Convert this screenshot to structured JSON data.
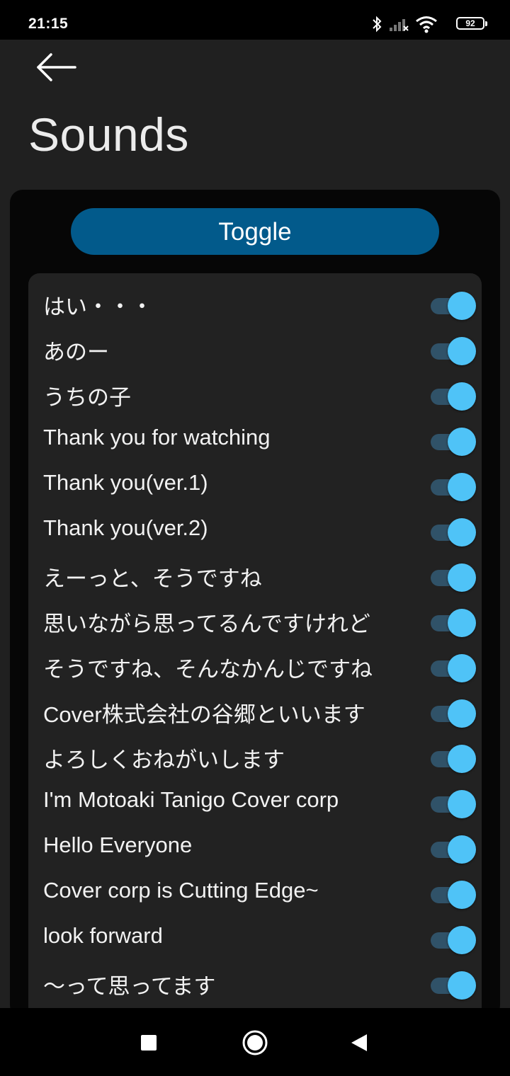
{
  "status_bar": {
    "time": "21:15",
    "battery_level": "92",
    "icons": [
      "bluetooth-icon",
      "signal-icon",
      "wifi-icon",
      "battery-icon"
    ]
  },
  "header": {
    "back_icon": "arrow-left-icon",
    "title": "Sounds"
  },
  "toggle_button": {
    "label": "Toggle",
    "color": "#025a8b"
  },
  "sounds": [
    {
      "label": "はい・・・",
      "enabled": true
    },
    {
      "label": "あのー",
      "enabled": true
    },
    {
      "label": "うちの子",
      "enabled": true
    },
    {
      "label": "Thank you for watching",
      "enabled": true
    },
    {
      "label": "Thank you(ver.1)",
      "enabled": true
    },
    {
      "label": "Thank you(ver.2)",
      "enabled": true
    },
    {
      "label": "えーっと、そうですね",
      "enabled": true
    },
    {
      "label": "思いながら思ってるんですけれど",
      "enabled": true
    },
    {
      "label": "そうですね、そんなかんじですね",
      "enabled": true
    },
    {
      "label": "Cover株式会社の谷郷といいます",
      "enabled": true
    },
    {
      "label": "よろしくおねがいします",
      "enabled": true
    },
    {
      "label": "I'm Motoaki Tanigo Cover corp",
      "enabled": true
    },
    {
      "label": "Hello Everyone",
      "enabled": true
    },
    {
      "label": "Cover corp is Cutting Edge~",
      "enabled": true
    },
    {
      "label": "look forward",
      "enabled": true
    },
    {
      "label": "～って思ってます",
      "enabled": true
    }
  ],
  "switch_colors": {
    "thumb": "#4fc3f7",
    "track": "#305268"
  },
  "nav_bar": {
    "buttons": [
      "recents-square-icon",
      "home-circle-icon",
      "back-triangle-icon"
    ]
  }
}
